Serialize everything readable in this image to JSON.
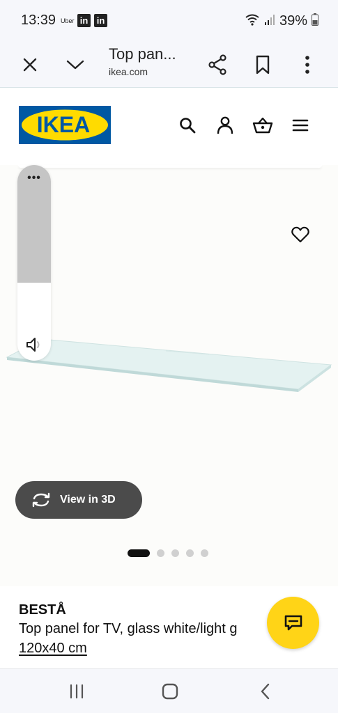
{
  "status_bar": {
    "time": "13:39",
    "uber_label": "Uber",
    "linkedin_1": "in",
    "linkedin_2": "in",
    "battery": "39%",
    "icons": [
      "wifi-icon",
      "signal-icon",
      "battery-icon"
    ]
  },
  "browser": {
    "tab_title": "Top pan...",
    "domain": "ikea.com",
    "icons": [
      "close-icon",
      "chevron-down-icon",
      "share-icon",
      "bookmark-icon",
      "more-vertical-icon"
    ]
  },
  "header": {
    "logo_text": "IKEA",
    "icons": [
      "search-icon",
      "account-icon",
      "basket-icon",
      "menu-icon"
    ]
  },
  "gallery": {
    "view_3d_label": "View in 3D",
    "total_images": 5,
    "active_index": 0
  },
  "volume_overlay": {
    "menu_label": "•••",
    "level": 0.6
  },
  "product": {
    "name": "BESTÅ",
    "description": "Top panel for TV, glass white/light g",
    "size": "120x40 cm"
  },
  "colors": {
    "ikea_blue": "#0058a3",
    "ikea_yellow": "#ffdb00",
    "chat_yellow": "#ffd417",
    "view3d_bg": "#4b4b4b"
  },
  "system_nav": {
    "icons": [
      "recents-icon",
      "home-icon",
      "back-icon"
    ]
  }
}
